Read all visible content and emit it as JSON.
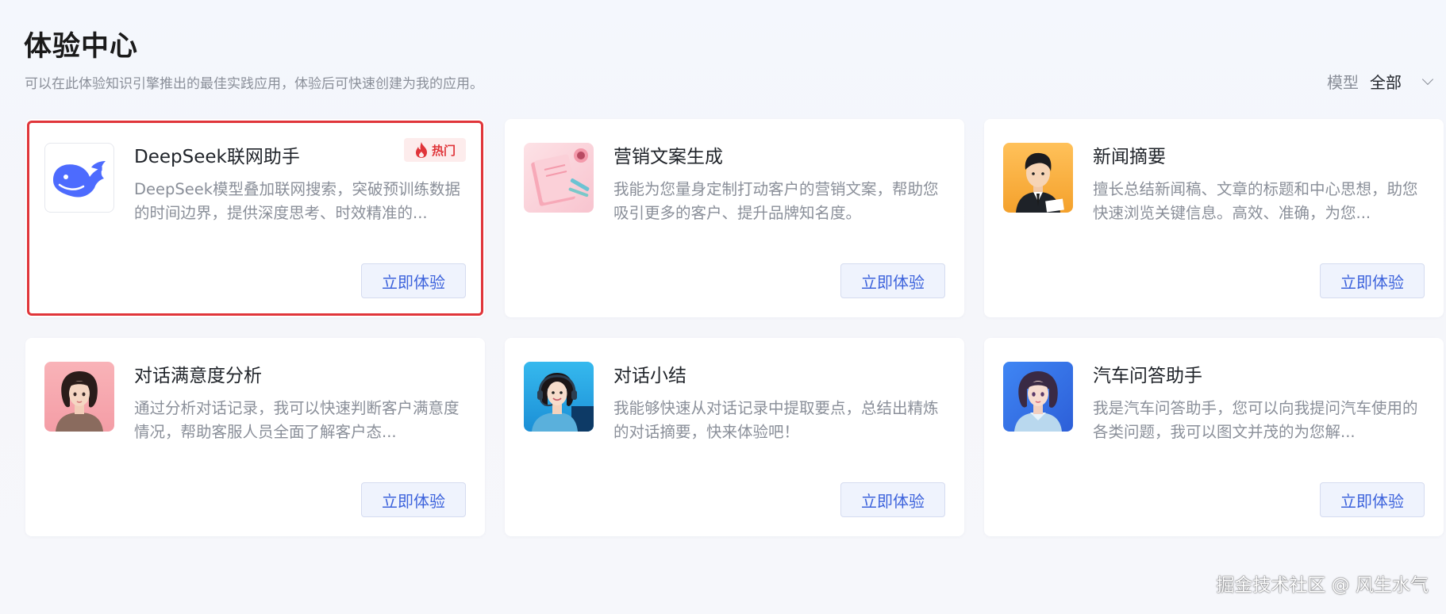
{
  "header": {
    "title": "体验中心",
    "subtitle": "可以在此体验知识引擎推出的最佳实践应用，体验后可快速创建为我的应用。"
  },
  "filter": {
    "label": "模型",
    "value": "全部",
    "icon": "chevron-down-icon"
  },
  "cards": [
    {
      "title": "DeepSeek联网助手",
      "description": "DeepSeek模型叠加联网搜索，突破预训练数据的时间边界，提供深度思考、时效精准的...",
      "button": "立即体验",
      "badge": "热门",
      "badge_icon": "fire-icon",
      "thumbnail": "deepseek-whale-logo",
      "highlighted": true
    },
    {
      "title": "营销文案生成",
      "description": "我能为您量身定制打动客户的营销文案，帮助您吸引更多的客户、提升品牌知名度。",
      "button": "立即体验",
      "thumbnail": "pink-notebook-illustration"
    },
    {
      "title": "新闻摘要",
      "description": "擅长总结新闻稿、文章的标题和中心思想，助您快速浏览关键信息。高效、准确，为您...",
      "button": "立即体验",
      "thumbnail": "anchorman-avatar"
    },
    {
      "title": "对话满意度分析",
      "description": "通过分析对话记录，我可以快速判断客户满意度情况，帮助客服人员全面了解客户态...",
      "button": "立即体验",
      "thumbnail": "woman-portrait-avatar"
    },
    {
      "title": "对话小结",
      "description": "我能够快速从对话记录中提取要点，总结出精炼的对话摘要，快来体验吧！",
      "button": "立即体验",
      "thumbnail": "headset-agent-avatar"
    },
    {
      "title": "汽车问答助手",
      "description": "我是汽车问答助手，您可以向我提问汽车使用的各类问题，我可以图文并茂的为您解...",
      "button": "立即体验",
      "thumbnail": "girl-blue-background-avatar"
    }
  ],
  "watermark": "掘金技术社区 @ 风生水气",
  "colors": {
    "accent": "#3d63dc",
    "button_bg": "#eff3fd",
    "highlight_border": "#e0353a",
    "hot_badge_bg": "#fdecec"
  }
}
